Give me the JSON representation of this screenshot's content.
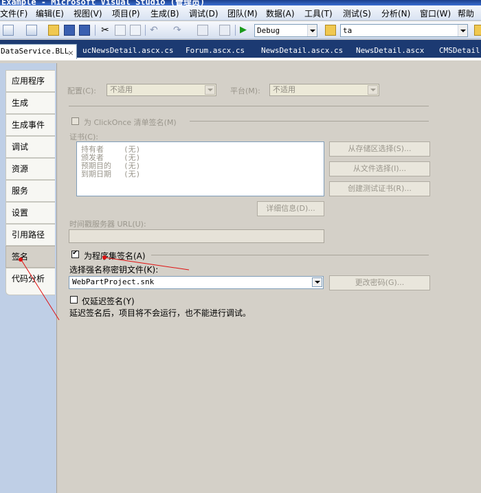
{
  "window": {
    "title": "Example - Microsoft Visual Studio (管理员)"
  },
  "menu": [
    "文件(F)",
    "编辑(E)",
    "视图(V)",
    "项目(P)",
    "生成(B)",
    "调试(D)",
    "团队(M)",
    "数据(A)",
    "工具(T)",
    "测试(S)",
    "分析(N)",
    "窗口(W)",
    "帮助"
  ],
  "toolbar": {
    "config_value": "Debug",
    "search_value": "ta"
  },
  "doc_tabs": [
    {
      "label": "DataService.BLL"
    },
    {
      "label": "ucNewsDetail.ascx.cs"
    },
    {
      "label": "Forum.ascx.cs"
    },
    {
      "label": "NewsDetail.ascx.cs"
    },
    {
      "label": "NewsDetail.ascx"
    },
    {
      "label": "CMSDetail."
    }
  ],
  "side_tabs": [
    "应用程序",
    "生成",
    "生成事件",
    "调试",
    "资源",
    "服务",
    "设置",
    "引用路径",
    "签名",
    "代码分析"
  ],
  "signing": {
    "config_label": "配置(C):",
    "config_value": "不适用",
    "platform_label": "平台(M):",
    "platform_value": "不适用",
    "clickonce_label": "为 ClickOnce 清单签名(M)",
    "cert_label": "证书(C):",
    "cert_rows": [
      {
        "key": "持有者",
        "value": "(无)"
      },
      {
        "key": "颁发者",
        "value": "(无)"
      },
      {
        "key": "预期目的",
        "value": "(无)"
      },
      {
        "key": "到期日期",
        "value": "(无)"
      }
    ],
    "btn_store": "从存储区选择(S)...",
    "btn_file": "从文件选择(I)...",
    "btn_test_cert": "创建测试证书(R)...",
    "btn_details": "详细信息(D)...",
    "timestamp_label": "时间戳服务器 URL(U):",
    "assembly_sign_label": "为程序集签名(A)",
    "key_file_label": "选择强名称密钥文件(K):",
    "key_file_value": "WebPartProject.snk",
    "btn_change_password": "更改密码(G)...",
    "delay_sign_label": "仅延迟签名(Y)",
    "delay_sign_note": "延迟签名后，项目将不会运行，也不能进行调试。"
  },
  "colors": {
    "annotation": "#e01010",
    "doc_tab_bar": "#1c3a72"
  }
}
